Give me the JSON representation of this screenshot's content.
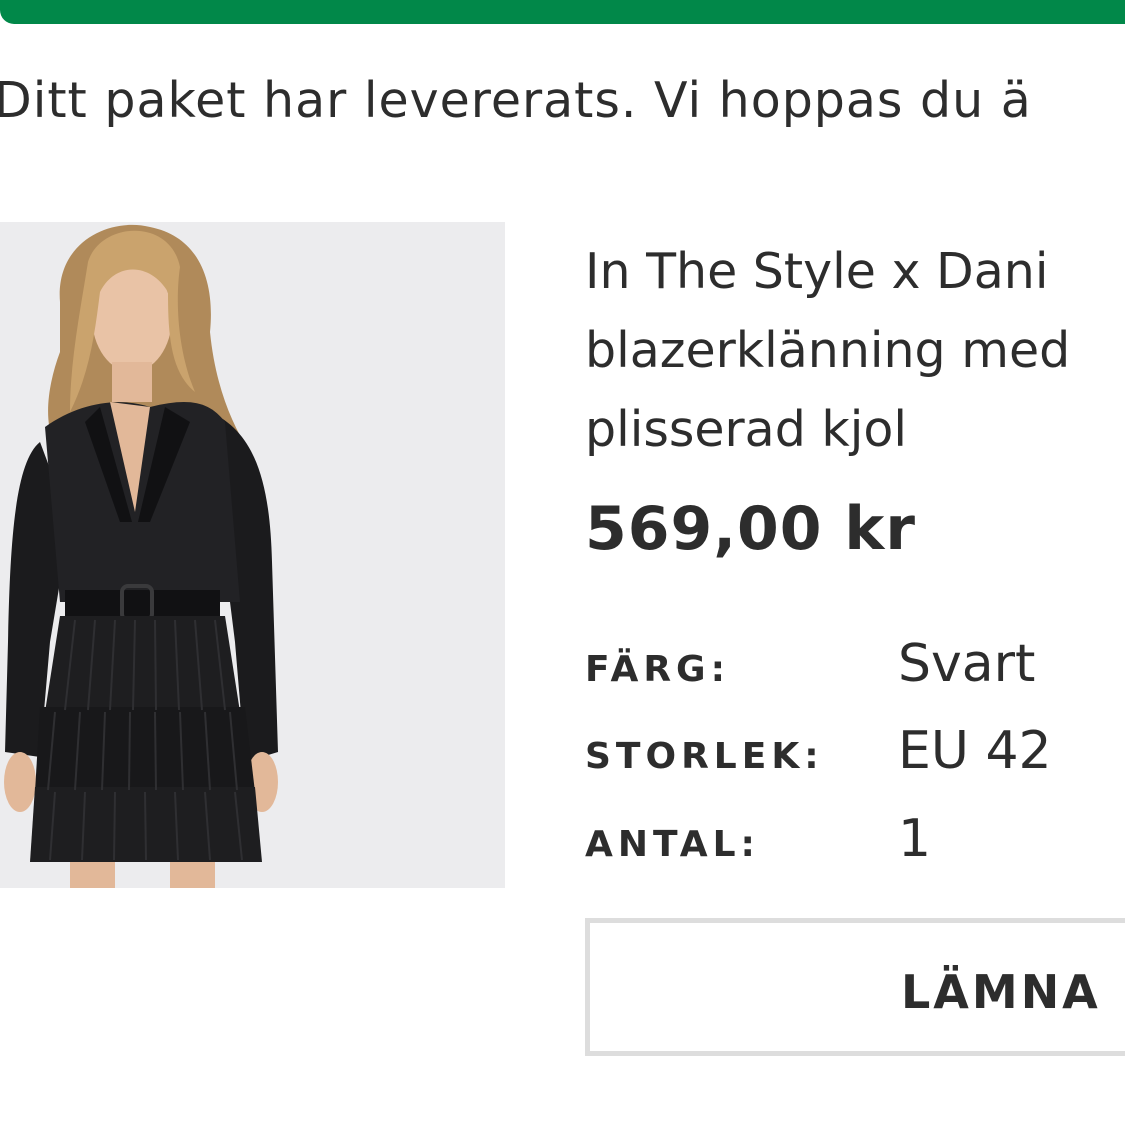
{
  "header": {
    "accent_color": "#018849"
  },
  "delivery": {
    "message": "Ditt paket har levererats. Vi hoppas du ä"
  },
  "product": {
    "image_icon": "product-photo-black-blazer-dress",
    "title_lines": [
      "In The Style x Dani",
      "blazerklänning med",
      "plisserad kjol"
    ],
    "price": "569,00 kr",
    "attributes": {
      "color_label": "FÄRG:",
      "color_value": "Svart",
      "size_label": "STORLEK:",
      "size_value": "EU 42",
      "quantity_label": "ANTAL:",
      "quantity_value": "1"
    }
  },
  "actions": {
    "return_label": "LÄMNA"
  }
}
